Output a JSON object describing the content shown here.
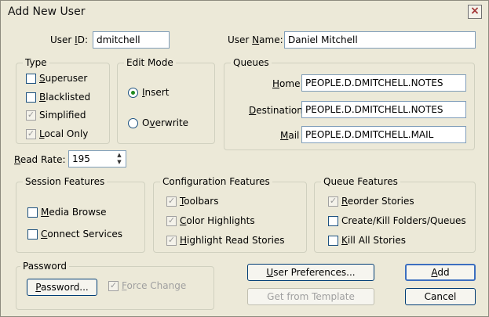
{
  "window": {
    "title": "Add New User",
    "close_glyph": "×"
  },
  "user_id": {
    "label_pre": "User ",
    "label_u": "I",
    "label_post": "D:",
    "value": "dmitchell"
  },
  "user_name": {
    "label_pre": "User ",
    "label_u": "N",
    "label_post": "ame:",
    "value": "Daniel Mitchell"
  },
  "type": {
    "title": "Type",
    "items": [
      {
        "u": "S",
        "rest": "uperuser",
        "checked": false,
        "disabled": false
      },
      {
        "u": "B",
        "rest": "lacklisted",
        "checked": false,
        "disabled": false
      },
      {
        "u": "",
        "rest": "Simplified",
        "checked": true,
        "disabled": true
      },
      {
        "u": "L",
        "rest": "ocal Only",
        "checked": true,
        "disabled": false
      }
    ]
  },
  "edit_mode": {
    "title": "Edit Mode",
    "insert": {
      "u": "I",
      "rest": "nsert",
      "selected": true
    },
    "overwrite": {
      "pre": "O",
      "u": "v",
      "rest": "erwrite",
      "selected": false
    }
  },
  "queues": {
    "title": "Queues",
    "home": {
      "u": "H",
      "rest": "ome",
      "value": "PEOPLE.D.DMITCHELL.NOTES"
    },
    "destination": {
      "u": "D",
      "rest": "estination",
      "value": "PEOPLE.D.DMITCHELL.NOTES"
    },
    "mail": {
      "u": "M",
      "rest": "ail",
      "value": "PEOPLE.D.DMITCHELL.MAIL"
    }
  },
  "read_rate": {
    "u": "R",
    "rest": "ead Rate:",
    "value": "195"
  },
  "session_features": {
    "title": "Session Features",
    "items": [
      {
        "u": "M",
        "rest": "edia Browse",
        "checked": false
      },
      {
        "u": "C",
        "rest": "onnect Services",
        "checked": false
      }
    ]
  },
  "configuration_features": {
    "title": "Configuration Features",
    "items": [
      {
        "u": "T",
        "rest": "oolbars",
        "checked": true
      },
      {
        "u": "C",
        "rest": "olor Highlights",
        "checked": true
      },
      {
        "u": "H",
        "rest": "ighlight Read Stories",
        "checked": true
      }
    ]
  },
  "queue_features": {
    "title": "Queue Features",
    "items": [
      {
        "u": "R",
        "rest": "eorder Stories",
        "checked": true
      },
      {
        "u": "",
        "rest": "Create/Kill Folders/Queues",
        "checked": false
      },
      {
        "u": "K",
        "rest": "ill All Stories",
        "checked": false
      }
    ]
  },
  "password": {
    "title": "Password",
    "button": {
      "u": "P",
      "rest": "assword..."
    },
    "force_change": {
      "u": "F",
      "rest": "orce Change",
      "checked": true
    }
  },
  "buttons": {
    "user_preferences": {
      "u": "U",
      "rest": "ser Preferences..."
    },
    "get_from_template": "Get from Template",
    "add": {
      "u": "A",
      "rest": "dd"
    },
    "cancel": "Cancel"
  }
}
